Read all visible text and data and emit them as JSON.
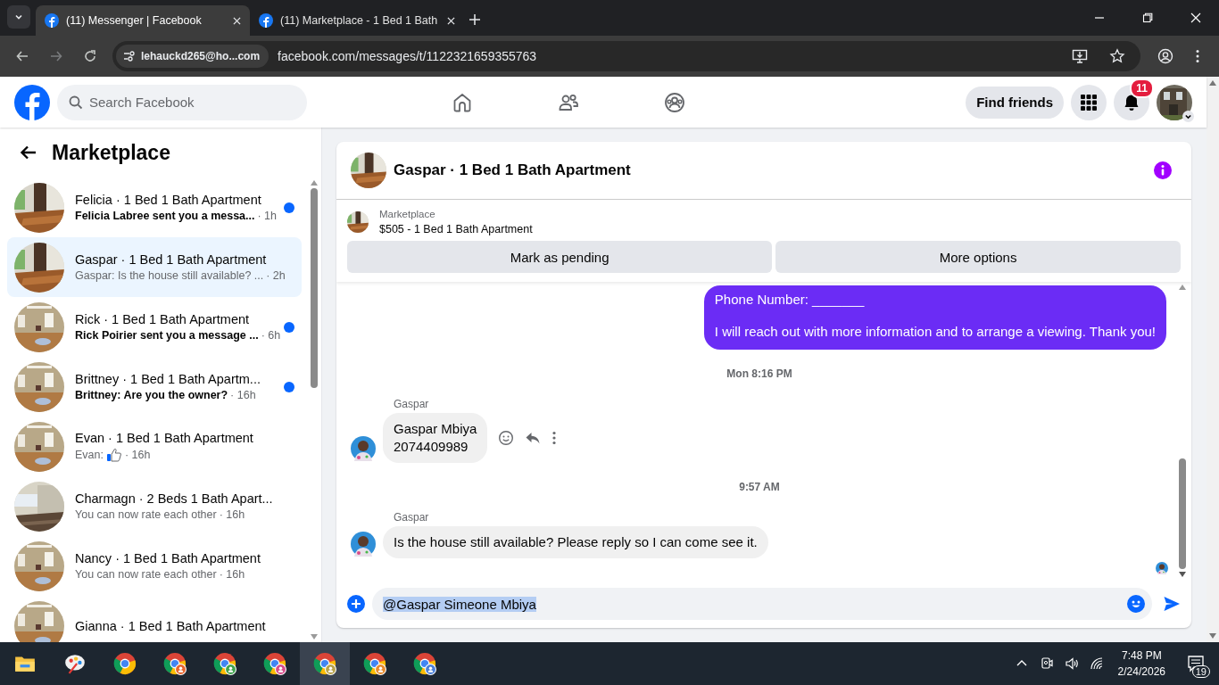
{
  "browser": {
    "tabs": [
      {
        "title": "(11) Messenger | Facebook",
        "selected": true
      },
      {
        "title": "(11) Marketplace - 1 Bed 1 Bath",
        "selected": false
      }
    ],
    "site_chip": "lehauckd265@ho...com",
    "url": "facebook.com/messages/t/1122321659355763"
  },
  "header": {
    "search": {
      "placeholder": "Search Facebook"
    },
    "find_friends": "Find friends",
    "notification_count": "11"
  },
  "sidebar": {
    "title": "Marketplace",
    "conversations": [
      {
        "title": "Felicia · 1 Bed 1 Bath Apartment",
        "preview": "Felicia Labree sent you a messa...",
        "time": "· 1h",
        "unread": true,
        "selected": false,
        "like_sent": false
      },
      {
        "title": "Gaspar · 1 Bed 1 Bath Apartment",
        "preview": "Gaspar: Is the house still available? ...",
        "time": "· 2h",
        "unread": false,
        "selected": true,
        "like_sent": false
      },
      {
        "title": "Rick · 1 Bed 1 Bath Apartment",
        "preview": "Rick Poirier sent you a message ...",
        "time": "· 6h",
        "unread": true,
        "selected": false,
        "like_sent": false
      },
      {
        "title": "Brittney · 1 Bed 1 Bath Apartm...",
        "preview": "Brittney: Are you the owner?",
        "time": "· 16h",
        "unread": true,
        "selected": false,
        "like_sent": false
      },
      {
        "title": "Evan · 1 Bed 1 Bath Apartment",
        "preview": "Evan:",
        "time": "· 16h",
        "unread": false,
        "selected": false,
        "like_sent": true
      },
      {
        "title": "Charmagn · 2 Beds 1 Bath Apart...",
        "preview": "You can now rate each other",
        "time": "· 16h",
        "unread": false,
        "selected": false,
        "like_sent": false
      },
      {
        "title": "Nancy · 1 Bed 1 Bath Apartment",
        "preview": "You can now rate each other",
        "time": "· 16h",
        "unread": false,
        "selected": false,
        "like_sent": false
      },
      {
        "title": "Gianna · 1 Bed 1 Bath Apartment"
      }
    ]
  },
  "chat": {
    "title": "Gaspar · 1 Bed 1 Bath Apartment",
    "listing": {
      "label": "Marketplace",
      "name": "$505 - 1 Bed 1 Bath Apartment",
      "buttons": [
        "Mark as pending",
        "More options"
      ]
    },
    "messages": [
      {
        "kind": "outgoing",
        "lines": [
          "Phone Number: _______",
          "I will reach out with more information and to arrange a viewing. Thank you!"
        ]
      },
      {
        "kind": "timestamp",
        "text": "Mon 8:16 PM"
      },
      {
        "kind": "incoming",
        "sender": "Gaspar",
        "lines": [
          "Gaspar Mbiya",
          "2074409989"
        ],
        "hover_actions": true
      },
      {
        "kind": "timestamp",
        "text": "9:57 AM"
      },
      {
        "kind": "incoming",
        "sender": "Gaspar",
        "lines": [
          "Is the house still available? Please reply so I can come see it."
        ],
        "hover_actions": false
      }
    ],
    "composer": {
      "value": "@Gaspar Simeone Mbiya",
      "text_selected": true
    }
  },
  "taskbar": {
    "time": "7:48 PM",
    "date": "2/24/2026",
    "notifications": "19"
  }
}
